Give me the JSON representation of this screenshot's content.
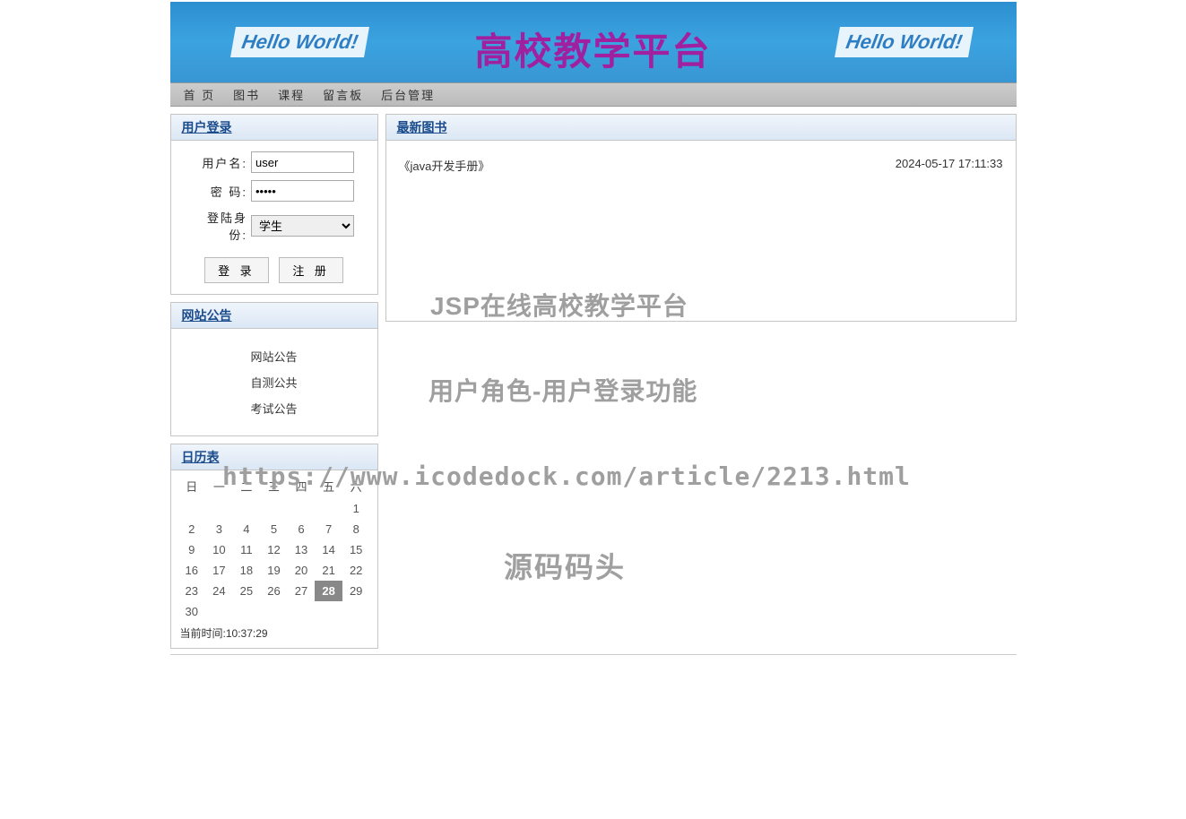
{
  "banner": {
    "title": "高校教学平台",
    "hello_left": "Hello World!",
    "hello_right": "Hello World!"
  },
  "nav": {
    "items": [
      "首 页",
      "图书",
      "课程",
      "留言板",
      "后台管理"
    ]
  },
  "login": {
    "header": "用户登录",
    "username_label": "用户名:",
    "username_value": "user",
    "password_label": "密  码:",
    "password_value": "•••••",
    "role_label": "登陆身份:",
    "role_value": "学生",
    "login_btn": "登 录",
    "register_btn": "注 册"
  },
  "notice": {
    "header": "网站公告",
    "items": [
      "网站公告",
      "自测公共",
      "考试公告"
    ]
  },
  "calendar": {
    "header": "日历表",
    "weekdays": [
      "日",
      "一",
      "二",
      "三",
      "四",
      "五",
      "六"
    ],
    "rows": [
      [
        "",
        "",
        "",
        "",
        "",
        "",
        "1"
      ],
      [
        "2",
        "3",
        "4",
        "5",
        "6",
        "7",
        "8"
      ],
      [
        "9",
        "10",
        "11",
        "12",
        "13",
        "14",
        "15"
      ],
      [
        "16",
        "17",
        "18",
        "19",
        "20",
        "21",
        "22"
      ],
      [
        "23",
        "24",
        "25",
        "26",
        "27",
        "28",
        "29"
      ],
      [
        "30",
        "",
        "",
        "",
        "",
        "",
        ""
      ]
    ],
    "today": "28",
    "time_label": "当前时间:",
    "time_value": "10:37:29"
  },
  "books": {
    "header": "最新图书",
    "item_title": "《java开发手册》",
    "item_date": "2024-05-17 17:11:33"
  },
  "watermarks": {
    "line1": "JSP在线高校教学平台",
    "line2": "用户角色-用户登录功能",
    "line3": "https://www.icodedock.com/article/2213.html",
    "line4": "源码码头"
  }
}
